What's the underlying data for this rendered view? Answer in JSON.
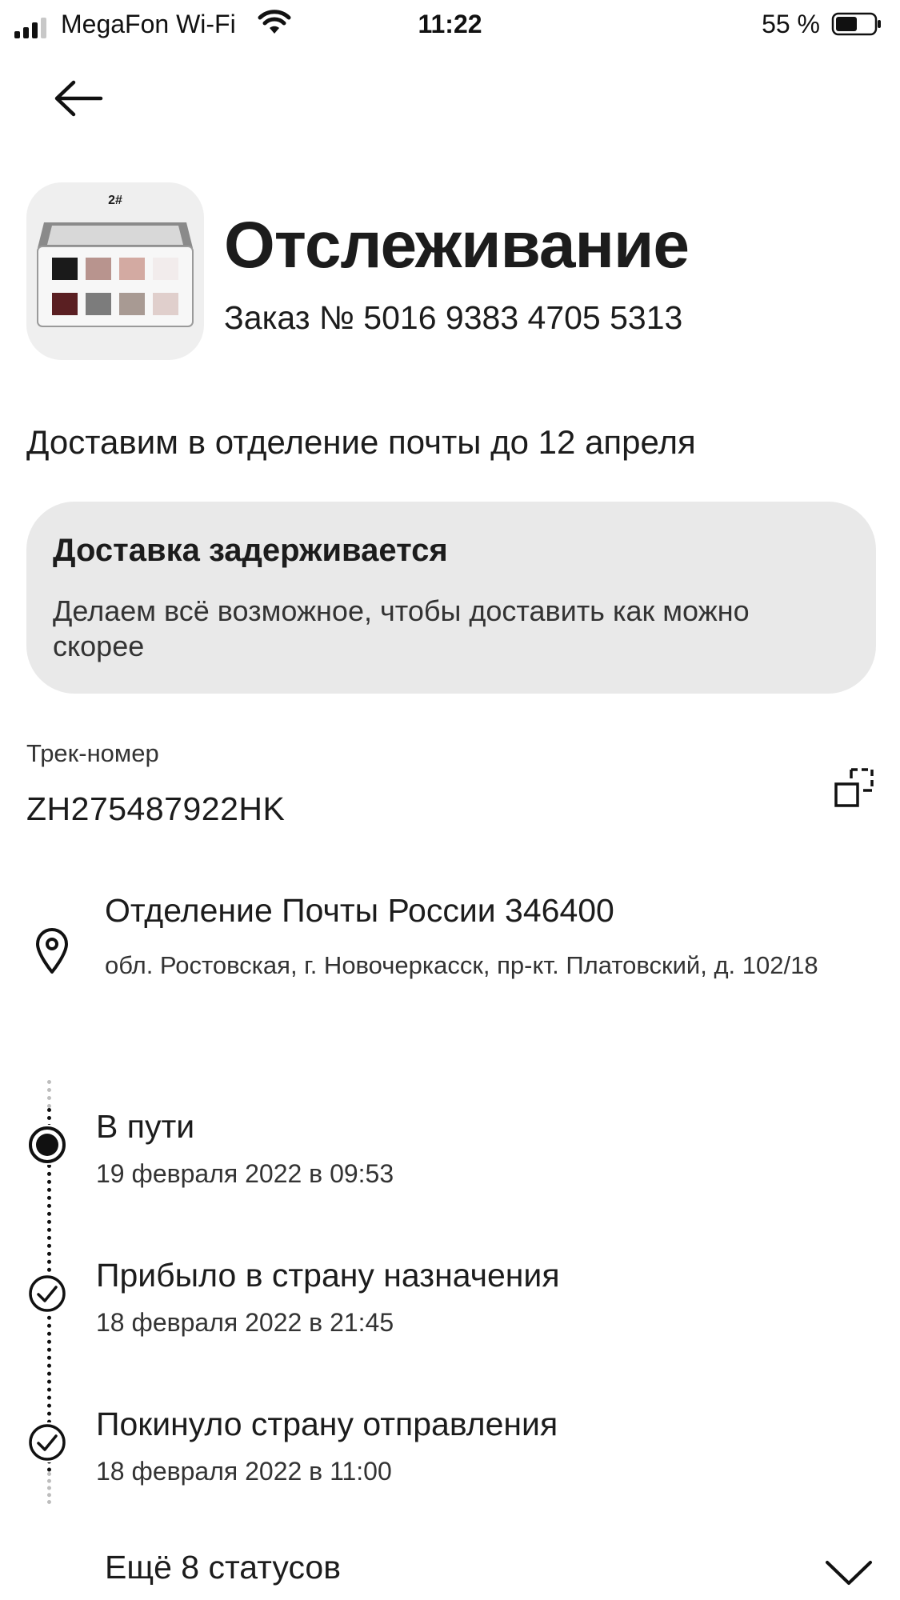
{
  "status_bar": {
    "carrier": "MegaFon Wi-Fi",
    "time": "11:22",
    "battery": "55 %"
  },
  "header": {
    "title": "Отслеживание",
    "order_number": "Заказ № 5016 9383 4705 5313",
    "product_image_label": "2#"
  },
  "delivery_estimate": "Доставим в отделение почты до 12 апреля",
  "notice": {
    "title": "Доставка задерживается",
    "text": "Делаем всё возможное, чтобы доставить как можно скорее"
  },
  "tracking": {
    "label": "Трек-номер",
    "number": "ZH275487922HK"
  },
  "post_office": {
    "name": "Отделение Почты России 346400",
    "address": "обл. Ростовская, г. Новочеркасск, пр-кт. Платовский, д. 102/18"
  },
  "statuses": [
    {
      "title": "В пути",
      "date": "19 февраля 2022 в 09:53",
      "state": "current"
    },
    {
      "title": "Прибыло в страну назначения",
      "date": "18 февраля 2022 в 21:45",
      "state": "done"
    },
    {
      "title": "Покинуло страну отправления",
      "date": "18 февраля 2022 в 11:00",
      "state": "done"
    }
  ],
  "more_statuses": "Ещё 8 статусов"
}
